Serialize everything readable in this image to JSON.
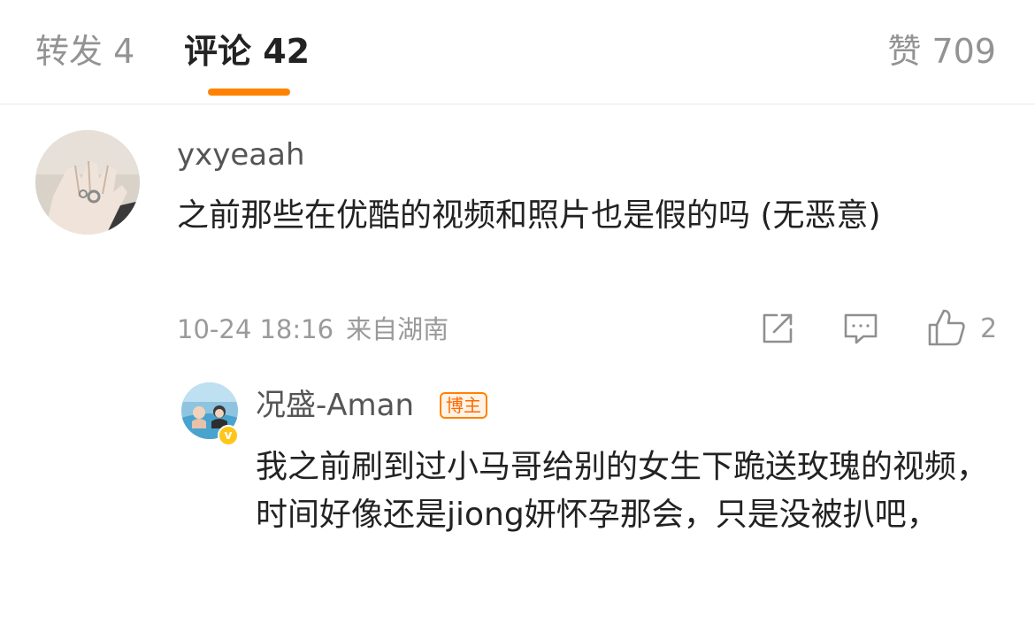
{
  "tabs": {
    "repost": "转发 4",
    "comments": "评论 42",
    "likes": "赞 709"
  },
  "colors": {
    "accent": "#ff8200",
    "muted_text": "#9a9a9a"
  },
  "comment": {
    "username": "yxyeaah",
    "text": "之前那些在优酷的视频和照片也是假的吗 (无恶意)",
    "time": "10-24 18:16",
    "location": "来自湖南",
    "like_count": "2",
    "icons": [
      "share-icon",
      "reply-icon",
      "like-icon"
    ]
  },
  "reply": {
    "username": "况盛-Aman",
    "badge": "博主",
    "verified_icon": "verified-badge-icon",
    "text": "我之前刷到过小马哥给别的女生下跪送玫瑰的视频，时间好像还是jiong妍怀孕那会，只是没被扒吧，"
  }
}
